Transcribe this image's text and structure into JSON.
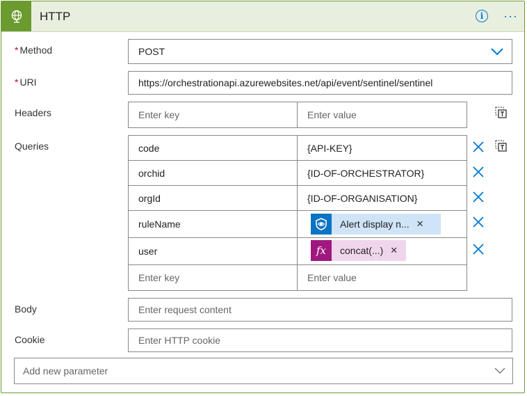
{
  "header": {
    "title": "HTTP",
    "info_icon": "info-icon",
    "more_icon": "ellipsis-icon",
    "accent": "#6b9a2f"
  },
  "method": {
    "label": "Method",
    "required_mark": "*",
    "value": "POST"
  },
  "uri": {
    "label": "URI",
    "required_mark": "*",
    "value": "https://orchestrationapi.azurewebsites.net/api/event/sentinel/sentinel"
  },
  "headers": {
    "label": "Headers",
    "key_placeholder": "Enter key",
    "value_placeholder": "Enter value"
  },
  "queries": {
    "label": "Queries",
    "rows": [
      {
        "key": "code",
        "value": "{API-KEY}"
      },
      {
        "key": "orchid",
        "value": "{ID-OF-ORCHESTRATOR}"
      },
      {
        "key": "orgId",
        "value": "{ID-OF-ORGANISATION}"
      },
      {
        "key": "ruleName",
        "token": "Alert display n...",
        "token_icon": "sentinel-shield-icon",
        "token_color": "#cfe4f6"
      },
      {
        "key": "user",
        "token": "concat(...)",
        "token_icon": "fx-icon",
        "token_color": "#f0d6ec"
      }
    ],
    "key_placeholder": "Enter key",
    "value_placeholder": "Enter value"
  },
  "body": {
    "label": "Body",
    "placeholder": "Enter request content"
  },
  "cookie": {
    "label": "Cookie",
    "placeholder": "Enter HTTP cookie"
  },
  "add_param": {
    "placeholder": "Add new parameter"
  }
}
